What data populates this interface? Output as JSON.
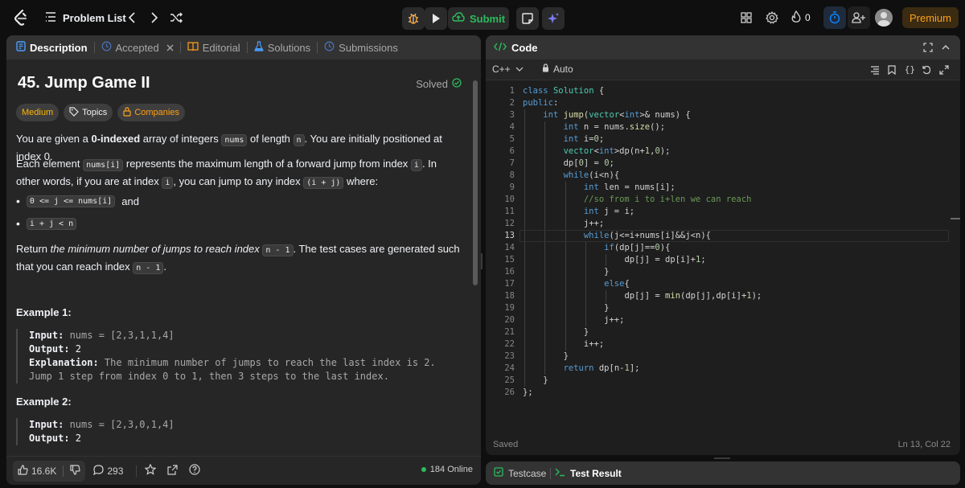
{
  "topbar": {
    "problem_list_label": "Problem List",
    "submit_label": "Submit",
    "streak_count": "0",
    "premium_label": "Premium"
  },
  "colors": {
    "submit_green": "#2cbb5d",
    "premium_orange": "#ffa116",
    "medium_orange": "#ffb800",
    "solved_green": "#2cbb5d",
    "timer_blue": "#0a84ff",
    "panel_bg": "#262626",
    "tab_bg": "#333333"
  },
  "left_tabs": [
    {
      "label": "Description",
      "icon": "description-icon"
    },
    {
      "label": "Accepted",
      "icon": "history-icon"
    },
    {
      "label": "Editorial",
      "icon": "book-icon"
    },
    {
      "label": "Solutions",
      "icon": "flask-icon"
    },
    {
      "label": "Submissions",
      "icon": "history-icon"
    }
  ],
  "problem": {
    "title": "45. Jump Game II",
    "status": "Solved",
    "difficulty": "Medium",
    "topics_label": "Topics",
    "companies_label": "Companies",
    "p1_a": "You are given a ",
    "p1_b": "0-indexed",
    "p1_c": " array of integers ",
    "p1_code1": "nums",
    "p1_d": " of length ",
    "p1_code2": "n",
    "p1_e": ". You are initially positioned at index 0.",
    "p2_a": "Each element ",
    "p2_code1": "nums[i]",
    "p2_b": " represents the maximum length of a forward jump from index ",
    "p2_code2": "i",
    "p2_c": ". In other words, if you are at index ",
    "p2_code3": "i",
    "p2_d": ", you can jump to any index ",
    "p2_code4": "(i + j)",
    "p2_e": " where:",
    "bullet1_code": "0 <= j <= nums[i]",
    "bullet1_text": " and",
    "bullet2_code": "i + j < n",
    "p3_a": "Return ",
    "p3_b": "the minimum number of jumps to reach index",
    "p3_code1": "n - 1",
    "p3_c": ". The test cases are generated such that you can reach index ",
    "p3_code2": "n - 1",
    "p3_d": ".",
    "example1_title": "Example 1:",
    "example1_input_label": "Input:",
    "example1_input": " nums = [2,3,1,1,4]",
    "example1_output_label": "Output:",
    "example1_output": " 2",
    "example1_expl_label": "Explanation:",
    "example1_expl": " The minimum number of jumps to reach the last index is 2. Jump 1 step from index 0 to 1, then 3 steps to the last index.",
    "example2_title": "Example 2:",
    "example2_input_label": "Input:",
    "example2_input": " nums = [2,3,0,1,4]",
    "example2_output_label": "Output:",
    "example2_output": " 2"
  },
  "left_footer": {
    "likes": "16.6K",
    "comments": "293",
    "online": "184 Online"
  },
  "code_panel": {
    "title": "Code",
    "language": "C++",
    "mode": "Auto",
    "saved_label": "Saved",
    "cursor_pos": "Ln 13, Col 22"
  },
  "bottom_tabs": {
    "testcase_label": "Testcase",
    "result_label": "Test Result"
  },
  "code_lines": [
    "class Solution {",
    "public:",
    "    int jump(vector<int>& nums) {",
    "        int n = nums.size();",
    "        int i=0;",
    "        vector<int>dp(n+1,0);",
    "        dp[0] = 0;",
    "        while(i<n){",
    "            int len = nums[i];",
    "            //so from i to i+len we can reach",
    "            int j = i;",
    "            j++;",
    "            while(j<=i+nums[i]&&j<n){",
    "                if(dp[j]==0){",
    "                    dp[j] = dp[i]+1;",
    "                }",
    "                else{",
    "                    dp[j] = min(dp[j],dp[i]+1);",
    "                }",
    "                j++;",
    "            }",
    "            i++;",
    "        }",
    "        return dp[n-1];",
    "    }",
    "};"
  ],
  "current_line": 13
}
